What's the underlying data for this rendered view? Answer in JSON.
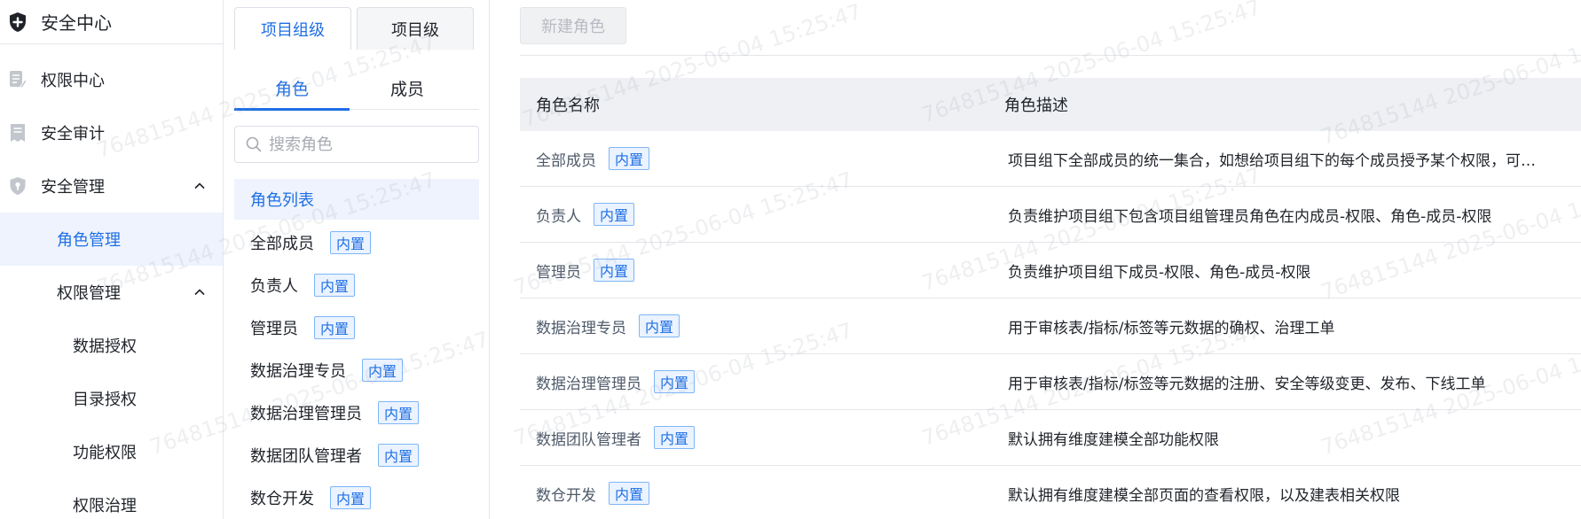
{
  "sidebar": {
    "title": "安全中心",
    "items": [
      {
        "label": "权限中心"
      },
      {
        "label": "安全审计"
      },
      {
        "label": "安全管理"
      }
    ],
    "security_children": [
      {
        "label": "角色管理"
      },
      {
        "label": "权限管理"
      }
    ],
    "permission_children": [
      {
        "label": "数据授权"
      },
      {
        "label": "目录授权"
      },
      {
        "label": "功能权限"
      },
      {
        "label": "权限治理"
      }
    ]
  },
  "role_panel": {
    "scope_tabs": [
      "项目组级",
      "项目级"
    ],
    "sub_tabs": [
      "角色",
      "成员"
    ],
    "search_placeholder": "搜索角色",
    "list_header": "角色列表",
    "roles": [
      {
        "name": "全部成员",
        "tag": "内置"
      },
      {
        "name": "负责人",
        "tag": "内置"
      },
      {
        "name": "管理员",
        "tag": "内置"
      },
      {
        "name": "数据治理专员",
        "tag": "内置"
      },
      {
        "name": "数据治理管理员",
        "tag": "内置"
      },
      {
        "name": "数据团队管理者",
        "tag": "内置"
      },
      {
        "name": "数仓开发",
        "tag": "内置"
      }
    ]
  },
  "main": {
    "new_role_button": "新建角色",
    "columns": [
      "角色名称",
      "角色描述"
    ],
    "rows": [
      {
        "name": "全部成员",
        "tag": "内置",
        "desc": "项目组下全部成员的统一集合，如想给项目组下的每个成员授予某个权限，可…"
      },
      {
        "name": "负责人",
        "tag": "内置",
        "desc": "负责维护项目组下包含项目组管理员角色在内成员-权限、角色-成员-权限"
      },
      {
        "name": "管理员",
        "tag": "内置",
        "desc": "负责维护项目组下成员-权限、角色-成员-权限"
      },
      {
        "name": "数据治理专员",
        "tag": "内置",
        "desc": "用于审核表/指标/标签等元数据的确权、治理工单"
      },
      {
        "name": "数据治理管理员",
        "tag": "内置",
        "desc": "用于审核表/指标/标签等元数据的注册、安全等级变更、发布、下线工单"
      },
      {
        "name": "数据团队管理者",
        "tag": "内置",
        "desc": "默认拥有维度建模全部功能权限"
      },
      {
        "name": "数仓开发",
        "tag": "内置",
        "desc": "默认拥有维度建模全部页面的查看权限，以及建表相关权限"
      }
    ]
  },
  "watermark": "764815144 2025-06-04 15:25:47",
  "colors": {
    "accent": "#1f6fe5",
    "badge_bg": "#eaf3ff",
    "badge_border": "#7fb6f5"
  },
  "icons": [
    "shield-plus-icon",
    "permission-center-icon",
    "audit-icon",
    "security-manage-icon",
    "chevron-up-icon",
    "search-icon"
  ]
}
